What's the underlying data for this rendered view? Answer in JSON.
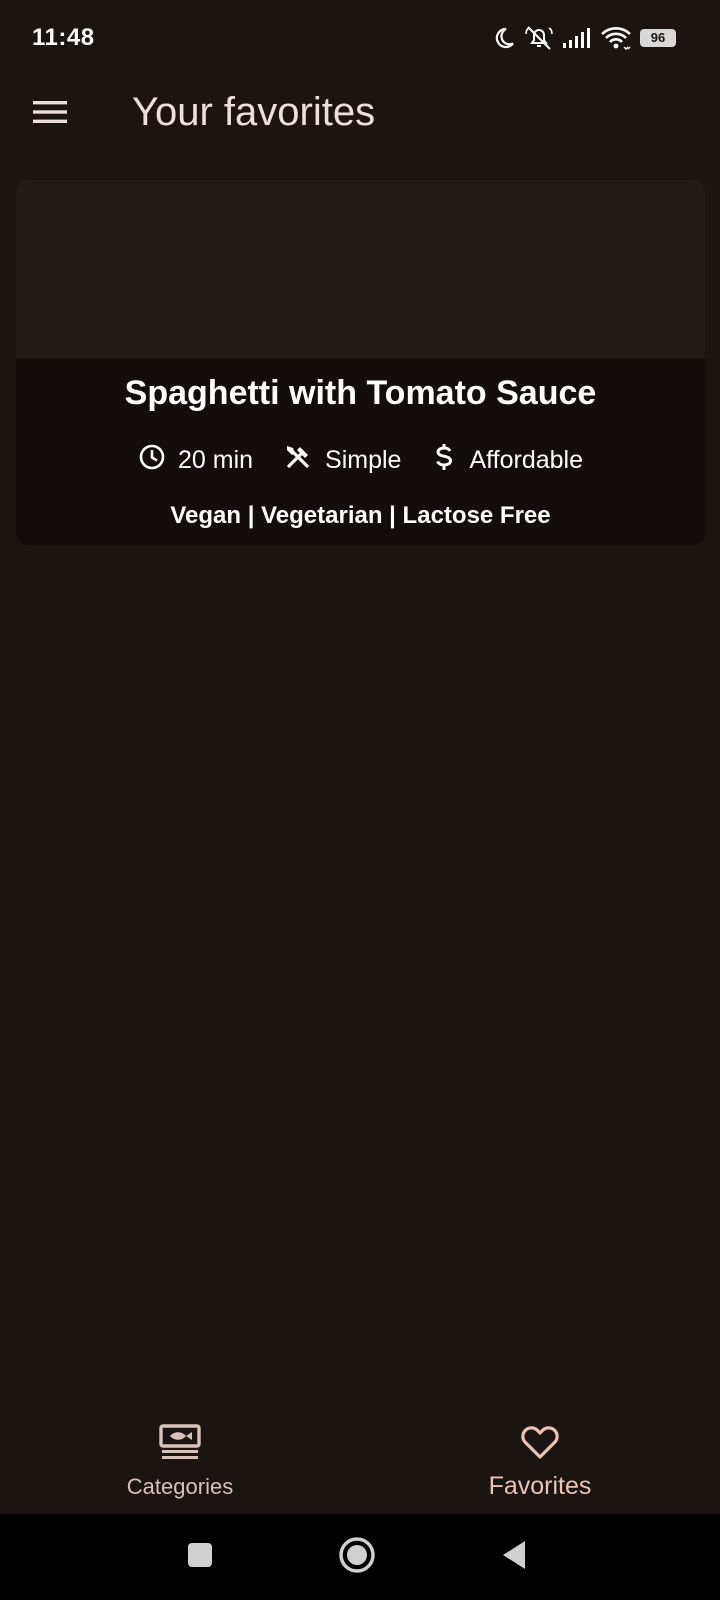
{
  "status_bar": {
    "time": "11:48",
    "battery": "96",
    "icons": [
      "moon-icon",
      "silent-bell-icon",
      "signal-icon",
      "wifi-icon",
      "battery-icon"
    ]
  },
  "app_bar": {
    "title": "Your favorites",
    "menu_icon": "hamburger-menu-icon"
  },
  "meals": [
    {
      "title": "Spaghetti with Tomato Sauce",
      "duration": "20 min",
      "complexity": "Simple",
      "affordability": "Affordable",
      "tags": "Vegan | Vegetarian | Lactose Free"
    }
  ],
  "bottom_nav": {
    "items": [
      {
        "label": "Categories",
        "icon": "set-meal-icon",
        "selected": false
      },
      {
        "label": "Favorites",
        "icon": "heart-outline-icon",
        "selected": true
      }
    ]
  },
  "system_nav": {
    "buttons": [
      "recents-icon",
      "home-icon",
      "back-icon"
    ]
  },
  "colors": {
    "background": "#1c1411",
    "card_overlay": "#130e0c",
    "image_placeholder": "#231b18",
    "accent": "#ecc4b4",
    "title_text": "#ede0dc"
  }
}
